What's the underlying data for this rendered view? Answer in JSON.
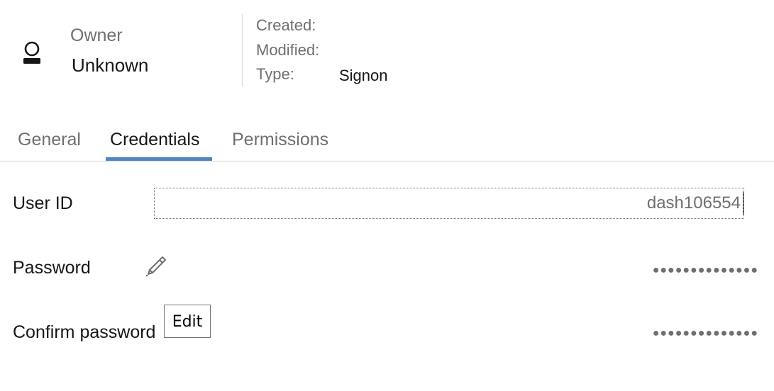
{
  "header": {
    "owner_label": "Owner",
    "owner_value": "Unknown",
    "owner_icon": "user-icon",
    "created_label": "Created:",
    "modified_label": "Modified:",
    "type_label": "Type:",
    "type_value": "Signon"
  },
  "tabs": [
    {
      "label": "General",
      "active": false
    },
    {
      "label": "Credentials",
      "active": true
    },
    {
      "label": "Permissions",
      "active": false
    }
  ],
  "form": {
    "user_id_label": "User ID",
    "user_id_value": "dash106554",
    "password_label": "Password",
    "password_masked": "●●●●●●●●●●●●●●",
    "confirm_label": "Confirm password",
    "confirm_masked": "●●●●●●●●●●●●●●",
    "edit_icon": "pencil-icon"
  },
  "tooltip": {
    "text": "Edit"
  },
  "colors": {
    "accent": "#4f86c0",
    "muted_text": "#6f6f6f",
    "primary_text": "#161616",
    "divider": "#d8d8d8"
  }
}
